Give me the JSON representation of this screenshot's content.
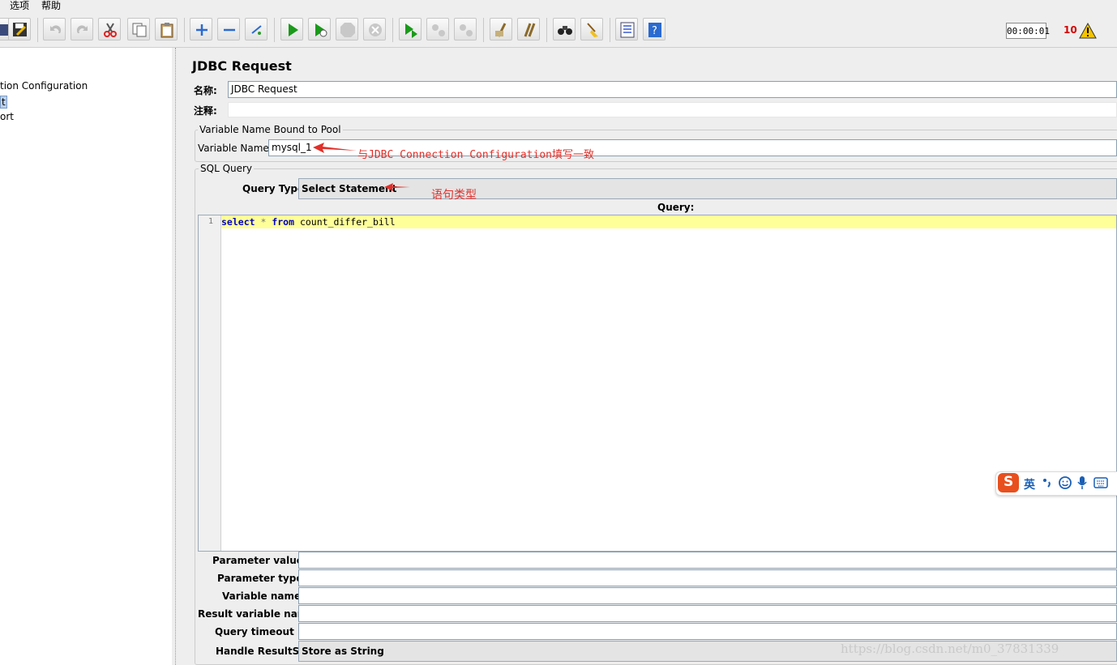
{
  "menu": {
    "options": "选项",
    "help": "帮助"
  },
  "toolbar": {
    "timer": "00:00:01",
    "error_count": "10",
    "buttons": [
      "save-icon",
      "undo-icon",
      "redo-icon",
      "cut-icon",
      "copy-icon",
      "paste-icon",
      "expand-icon",
      "collapse-icon",
      "toggle-icon",
      "start-icon",
      "start-no-pause-icon",
      "stop-icon",
      "shutdown-icon",
      "remote-start-icon",
      "remote-stop-icon",
      "remote-shutdown-icon",
      "clear-icon",
      "clear-all-icon",
      "search-icon",
      "reset-search-icon",
      "function-helper-icon",
      "help-icon"
    ],
    "accent_run": "#1a9a1a"
  },
  "tree": {
    "items": [
      "tion Configuration",
      "t",
      "ort"
    ]
  },
  "form": {
    "title": "JDBC Request",
    "name_label": "名称:",
    "name_value": "JDBC Request",
    "comment_label": "注释:",
    "comment_value": "",
    "pool_group": "Variable Name Bound to Pool",
    "variable_name_label": "Variable Name:",
    "variable_name_value": "mysql_1",
    "sql_group": "SQL Query",
    "query_type_label": "Query Type:",
    "query_type_value": "Select Statement",
    "query_label": "Query:",
    "line_number": "1",
    "code": {
      "kw1": "select",
      "star": " * ",
      "kw2": "from",
      "rest": " count_differ_bill"
    },
    "parameter_values_label": "Parameter values:",
    "parameter_types_label": "Parameter types:",
    "variable_names_label": "Variable names:",
    "result_variable_label": "Result variable name:",
    "query_timeout_label": "Query timeout (s):",
    "handle_resultset_label": "Handle ResultSet:",
    "handle_resultset_value": "Store as String"
  },
  "annotations": {
    "pool_note": "与JDBC Connection Configuration填写一致",
    "type_note": "语句类型",
    "color": "#e0302a"
  },
  "ime": {
    "lang": "英",
    "logo": "S"
  },
  "watermark": "https://blog.csdn.net/m0_37831339"
}
